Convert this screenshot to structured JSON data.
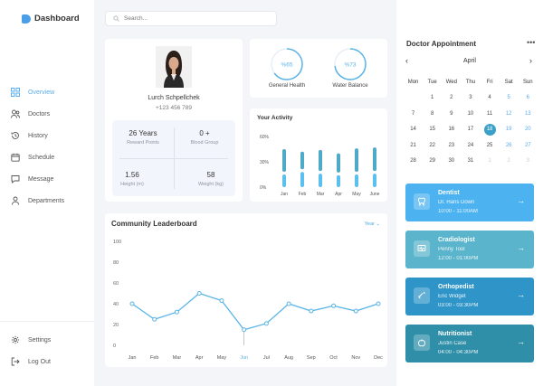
{
  "app": {
    "title": "Dashboard"
  },
  "search": {
    "placeholder": "Search..."
  },
  "nav": {
    "items": [
      {
        "label": "Overview"
      },
      {
        "label": "Doctors"
      },
      {
        "label": "History"
      },
      {
        "label": "Schedule"
      },
      {
        "label": "Message"
      },
      {
        "label": "Departments"
      }
    ],
    "settings": "Settings",
    "logout": "Log Out"
  },
  "profile": {
    "name": "Lurch Schpellchek",
    "phone": "+123 456 789",
    "stats": [
      {
        "value": "26 Years",
        "label": "Reward Points"
      },
      {
        "value": "0 +",
        "label": "Blood Group"
      },
      {
        "value": "1.56",
        "label": "Height (m)"
      },
      {
        "value": "58",
        "label": "Weight (kg)"
      }
    ]
  },
  "health": [
    {
      "value": "%65",
      "label": "General Health",
      "percent": 65
    },
    {
      "value": "%73",
      "label": "Water Balance",
      "percent": 73
    }
  ],
  "activity": {
    "title": "Your Activity",
    "yticks": [
      "60%",
      "30%",
      "0%"
    ],
    "months": [
      "Jan",
      "Feb",
      "Mar",
      "Apr",
      "May",
      "June"
    ],
    "series": [
      {
        "values": [
          15,
          18,
          16,
          14,
          15,
          16
        ]
      },
      {
        "values": [
          45,
          42,
          44,
          40,
          46,
          47
        ]
      }
    ]
  },
  "leaderboard": {
    "title": "Community Leaderboard",
    "filter": "Year",
    "chart_data": {
      "type": "line",
      "categories": [
        "Jan",
        "Feb",
        "Mar",
        "Apr",
        "May",
        "Jun",
        "Jul",
        "Aug",
        "Sep",
        "Oct",
        "Nov",
        "Dec"
      ],
      "values": [
        40,
        25,
        32,
        50,
        43,
        15,
        21,
        40,
        33,
        38,
        33,
        40
      ],
      "yticks": [
        0,
        20,
        40,
        60,
        80,
        100
      ],
      "ylim": [
        0,
        100
      ],
      "highlight": "Jun",
      "color": "#5ab4e6"
    }
  },
  "appointment": {
    "title": "Doctor Appointment",
    "menu": "•••",
    "prev": "‹",
    "next": "›",
    "month": "April",
    "weekdays": [
      "Mon",
      "Tue",
      "Wed",
      "Thu",
      "Fri",
      "Sat",
      "Sun"
    ],
    "weeks": [
      [
        "",
        "1",
        "2",
        "3",
        "4",
        "5",
        "6"
      ],
      [
        "7",
        "8",
        "9",
        "10",
        "11",
        "12",
        "13"
      ],
      [
        "14",
        "15",
        "16",
        "17",
        "18",
        "19",
        "20"
      ],
      [
        "21",
        "22",
        "23",
        "24",
        "25",
        "26",
        "27"
      ],
      [
        "28",
        "29",
        "30",
        "31",
        "1",
        "2",
        "3"
      ]
    ],
    "selected": "18",
    "cards": [
      {
        "title": "Dentist",
        "name": "Dr. Hans Down",
        "time": "10:00 - 11:00AM",
        "color": "#4db3f0",
        "icon": "tooth-icon"
      },
      {
        "title": "Cradiologist",
        "name": "Penny Tool",
        "time": "12:00 - 01:00PM",
        "color": "#5ab4cb",
        "icon": "heart-monitor-icon"
      },
      {
        "title": "Orthopedist",
        "name": "Eric Widget",
        "time": "03:00 - 03:30PM",
        "color": "#2f95c8",
        "icon": "bone-icon"
      },
      {
        "title": "Nutritionist",
        "name": "Justin Case",
        "time": "04:00 - 04:30PM",
        "color": "#2f8fa8",
        "icon": "apple-icon"
      }
    ]
  }
}
